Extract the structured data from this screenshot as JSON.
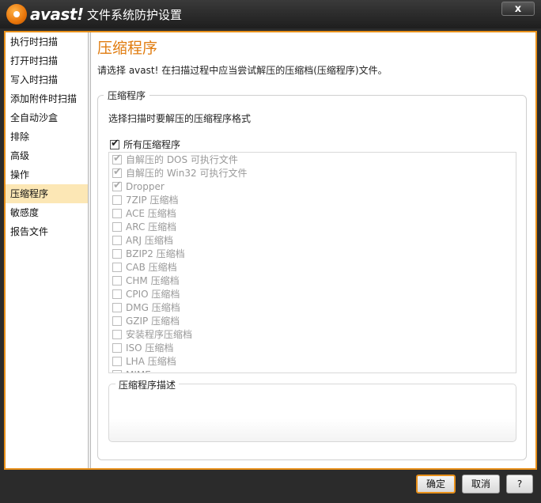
{
  "window": {
    "logo_text": "avast!",
    "title": "文件系统防护设置",
    "close": "x"
  },
  "sidebar": {
    "items": [
      {
        "label": "执行时扫描"
      },
      {
        "label": "打开时扫描"
      },
      {
        "label": "写入时扫描"
      },
      {
        "label": "添加附件时扫描"
      },
      {
        "label": "全自动沙盒"
      },
      {
        "label": "排除"
      },
      {
        "label": "高级"
      },
      {
        "label": "操作"
      },
      {
        "label": "压缩程序",
        "active": true
      },
      {
        "label": "敏感度"
      },
      {
        "label": "报告文件"
      }
    ]
  },
  "main": {
    "title": "压缩程序",
    "description": "请选择 avast! 在扫描过程中应当尝试解压的压缩档(压缩程序)文件。",
    "group_title": "压缩程序",
    "group_subtitle": "选择扫描时要解压的压缩程序格式",
    "all_label": "所有压缩程序",
    "all_checked": true,
    "packers": [
      {
        "label": "自解压的 DOS 可执行文件",
        "checked": true
      },
      {
        "label": "自解压的 Win32 可执行文件",
        "checked": true
      },
      {
        "label": "Dropper",
        "checked": true
      },
      {
        "label": "7ZIP 压缩档",
        "checked": false
      },
      {
        "label": "ACE 压缩档",
        "checked": false
      },
      {
        "label": "ARC 压缩档",
        "checked": false
      },
      {
        "label": "ARJ 压缩档",
        "checked": false
      },
      {
        "label": "BZIP2 压缩档",
        "checked": false
      },
      {
        "label": "CAB 压缩档",
        "checked": false
      },
      {
        "label": "CHM 压缩档",
        "checked": false
      },
      {
        "label": "CPIO 压缩档",
        "checked": false
      },
      {
        "label": "DMG 压缩档",
        "checked": false
      },
      {
        "label": "GZIP 压缩档",
        "checked": false
      },
      {
        "label": "安装程序压缩档",
        "checked": false
      },
      {
        "label": "ISO 压缩档",
        "checked": false
      },
      {
        "label": "LHA 压缩档",
        "checked": false
      },
      {
        "label": "MIME",
        "checked": false
      }
    ],
    "desc_title": "压缩程序描述"
  },
  "footer": {
    "ok": "确定",
    "cancel": "取消",
    "help": "?"
  },
  "colors": {
    "accent": "#e8901a",
    "title": "#e07c10",
    "active_bg": "#fce7b5"
  }
}
